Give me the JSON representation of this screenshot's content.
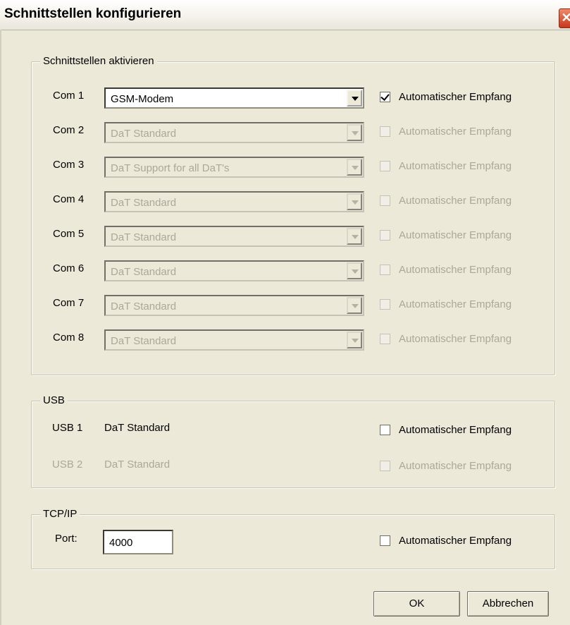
{
  "window": {
    "title": "Schnittstellen konfigurieren",
    "close_glyph": "✕"
  },
  "com_group": {
    "label": "Schnittstellen aktivieren",
    "ports": [
      {
        "name": "Com 1",
        "value": "GSM-Modem",
        "enabled": true,
        "auto_label": "Automatischer Empfang",
        "auto_checked": true
      },
      {
        "name": "Com 2",
        "value": "DaT Standard",
        "enabled": false,
        "auto_label": "Automatischer Empfang",
        "auto_checked": false
      },
      {
        "name": "Com 3",
        "value": "DaT Support for all DaT's",
        "enabled": false,
        "auto_label": "Automatischer Empfang",
        "auto_checked": false
      },
      {
        "name": "Com 4",
        "value": "DaT Standard",
        "enabled": false,
        "auto_label": "Automatischer Empfang",
        "auto_checked": false
      },
      {
        "name": "Com 5",
        "value": "DaT Standard",
        "enabled": false,
        "auto_label": "Automatischer Empfang",
        "auto_checked": false
      },
      {
        "name": "Com 6",
        "value": "DaT Standard",
        "enabled": false,
        "auto_label": "Automatischer Empfang",
        "auto_checked": false
      },
      {
        "name": "Com 7",
        "value": "DaT Standard",
        "enabled": false,
        "auto_label": "Automatischer Empfang",
        "auto_checked": false
      },
      {
        "name": "Com 8",
        "value": "DaT Standard",
        "enabled": false,
        "auto_label": "Automatischer Empfang",
        "auto_checked": false
      }
    ]
  },
  "usb_group": {
    "label": "USB",
    "ports": [
      {
        "name": "USB 1",
        "value": "DaT Standard",
        "enabled": true,
        "auto_label": "Automatischer Empfang",
        "auto_checked": false
      },
      {
        "name": "USB 2",
        "value": "DaT Standard",
        "enabled": false,
        "auto_label": "Automatischer Empfang",
        "auto_checked": false
      }
    ]
  },
  "tcp_group": {
    "label": "TCP/IP",
    "port_label": "Port:",
    "port_value": "4000",
    "auto_label": "Automatischer Empfang",
    "auto_checked": false
  },
  "buttons": {
    "ok": "OK",
    "cancel": "Abbrechen"
  }
}
